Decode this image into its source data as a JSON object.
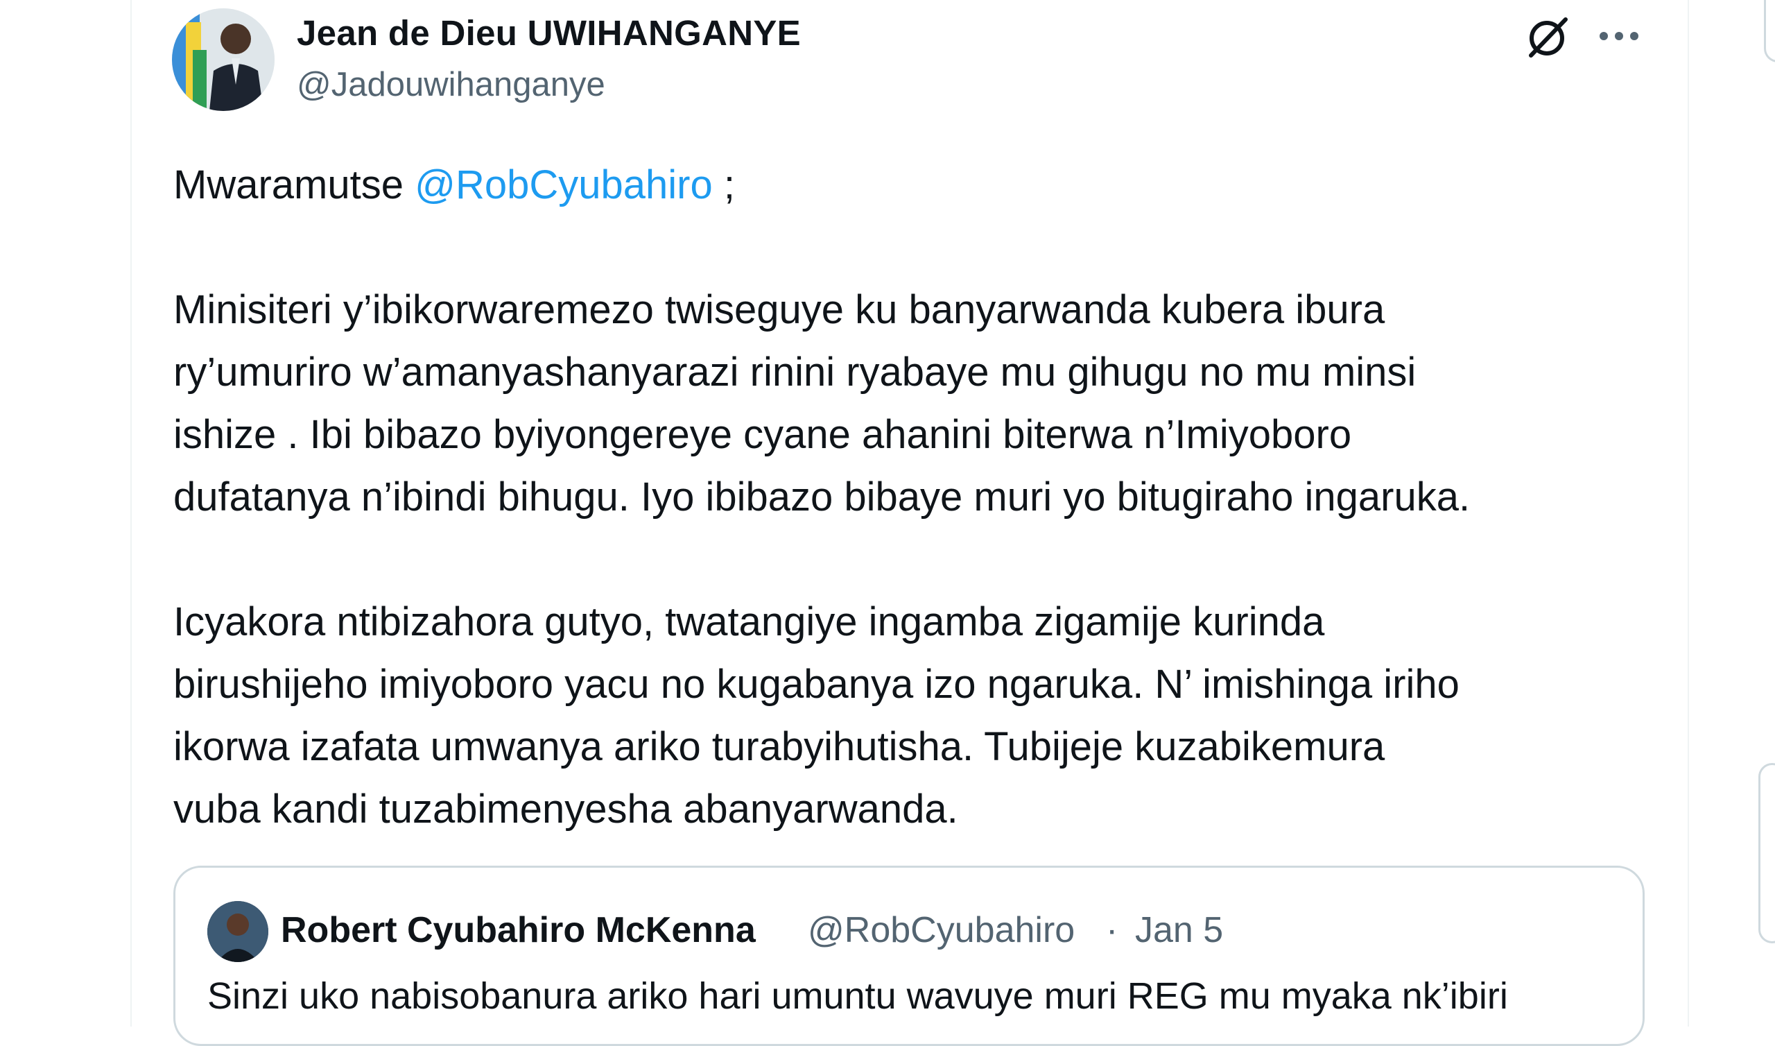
{
  "tweet": {
    "author_name": "Jean de Dieu UWIHANGANYE",
    "author_handle": "@Jadouwihanganye",
    "greeting": "Mwaramutse ",
    "mention": "@RobCyubahiro",
    "greeting_end": " ;",
    "paragraph2_lines": [
      "Minisiteri y’ibikorwaremezo twiseguye ku banyarwanda kubera ibura",
      "ry’umuriro w’amanyashanyarazi rinini ryabaye mu gihugu no mu minsi",
      "ishize . Ibi bibazo byiyongereye cyane ahanini biterwa n’Imiyoboro",
      "dufatanya n’ibindi bihugu. Iyo ibibazo bibaye muri yo bitugiraho ingaruka."
    ],
    "paragraph3_lines": [
      "Icyakora ntibizahora gutyo, twatangiye ingamba zigamije kurinda",
      "birushijeho imiyoboro yacu no kugabanya izo ngaruka. N’ imishinga iriho",
      "ikorwa izafata umwanya ariko turabyihutisha. Tubijeje kuzabikemura",
      "vuba kandi tuzabimenyesha abanyarwanda."
    ],
    "icons": [
      "grok-icon",
      "more-icon"
    ]
  },
  "quoted": {
    "name": "Robert Cyubahiro McKenna",
    "handle": "@RobCyubahiro",
    "separator": "·",
    "date": "Jan 5",
    "text_partial": "Sinzi uko nabisobanura ariko hari umuntu wavuye muri REG mu myaka nk’ibiri"
  },
  "colors": {
    "text": "#0f1419",
    "secondary": "#536471",
    "link": "#1d9bf0",
    "border": "#cfd9de"
  }
}
